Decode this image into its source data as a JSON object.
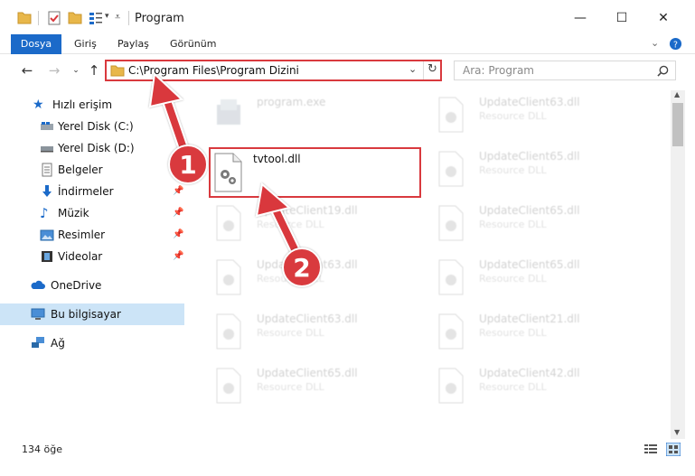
{
  "window": {
    "title": "Program",
    "minimize": "—",
    "maximize": "☐",
    "close": "✕"
  },
  "ribbon": {
    "tabs": [
      "Dosya",
      "Giriş",
      "Paylaş",
      "Görünüm"
    ]
  },
  "nav": {
    "path": "C:\\Program Files\\Program Dizini",
    "search_placeholder": "Ara: Program"
  },
  "sidebar": {
    "quick_access": "Hızlı erişim",
    "items": [
      {
        "label": "Yerel Disk (C:)",
        "icon": "drive-icon",
        "pinned": false
      },
      {
        "label": "Yerel Disk (D:)",
        "icon": "drive-icon",
        "pinned": false
      },
      {
        "label": "Belgeler",
        "icon": "documents-icon",
        "pinned": true
      },
      {
        "label": "İndirmeler",
        "icon": "download-icon",
        "pinned": true
      },
      {
        "label": "Müzik",
        "icon": "music-icon",
        "pinned": true
      },
      {
        "label": "Resimler",
        "icon": "pictures-icon",
        "pinned": true
      },
      {
        "label": "Videolar",
        "icon": "videos-icon",
        "pinned": true
      }
    ],
    "onedrive": "OneDrive",
    "this_pc": "Bu bilgisayar",
    "network": "Ağ"
  },
  "files": {
    "main": {
      "name": "tvtool.dll"
    },
    "faded": [
      {
        "name": "program.exe",
        "type": ""
      },
      {
        "name": "UpdateClient63.dll",
        "type": "Resource DLL"
      },
      {
        "name": "UpdateClient65.dll",
        "type": "Resource DLL"
      },
      {
        "name": "UpdateClient19.dll",
        "type": "Resource DLL"
      },
      {
        "name": "UpdateClient65.dll",
        "type": "Resource DLL"
      },
      {
        "name": "UpdateClient63.dll",
        "type": "Resource DLL"
      },
      {
        "name": "UpdateClient65.dll",
        "type": "Resource DLL"
      },
      {
        "name": "UpdateClient63.dll",
        "type": "Resource DLL"
      },
      {
        "name": "UpdateClient21.dll",
        "type": "Resource DLL"
      },
      {
        "name": "UpdateClient65.dll",
        "type": "Resource DLL"
      },
      {
        "name": "UpdateClient42.dll",
        "type": "Resource DLL"
      }
    ]
  },
  "status": {
    "count": "134 öğe"
  },
  "annotations": {
    "step1": "1",
    "step2": "2"
  },
  "colors": {
    "accent": "#1b6ac9",
    "annotation_red": "#d9393e",
    "selected_bg": "#cce4f7"
  }
}
